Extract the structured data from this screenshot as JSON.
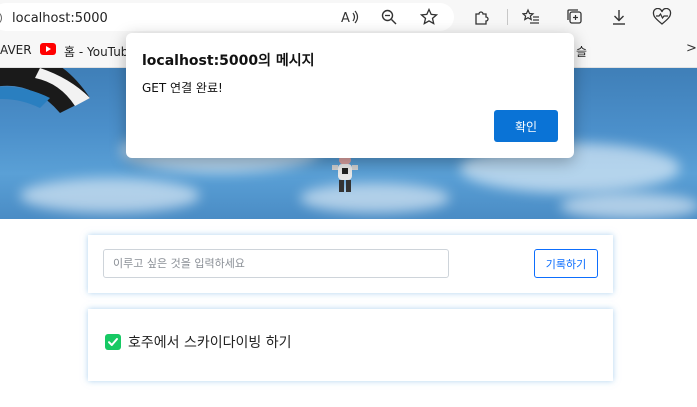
{
  "browser": {
    "url": "localhost:5000",
    "icons": [
      "info-icon",
      "read-aloud-icon",
      "zoom-out-icon",
      "favorite-star-icon",
      "extensions-icon",
      "favorites-list-icon",
      "collections-icon",
      "downloads-icon",
      "health-icon"
    ]
  },
  "bookmarks": {
    "left_fragment": "AVER",
    "youtube_label": "홈 - YouTub",
    "right_fragment": "슬",
    "more_symbol": ">"
  },
  "dialog": {
    "title": "localhost:5000의 메시지",
    "message": "GET 연결 완료!",
    "ok_label": "확인"
  },
  "goal_form": {
    "input_placeholder": "이루고 싶은 것을 입력하세요",
    "input_value": "",
    "record_label": "기록하기"
  },
  "todo": {
    "checked": true,
    "text": "호주에서 스카이다이빙 하기"
  },
  "colors": {
    "accent": "#0d6efd",
    "dialog_button": "#0a73d6",
    "check": "#17c964"
  }
}
